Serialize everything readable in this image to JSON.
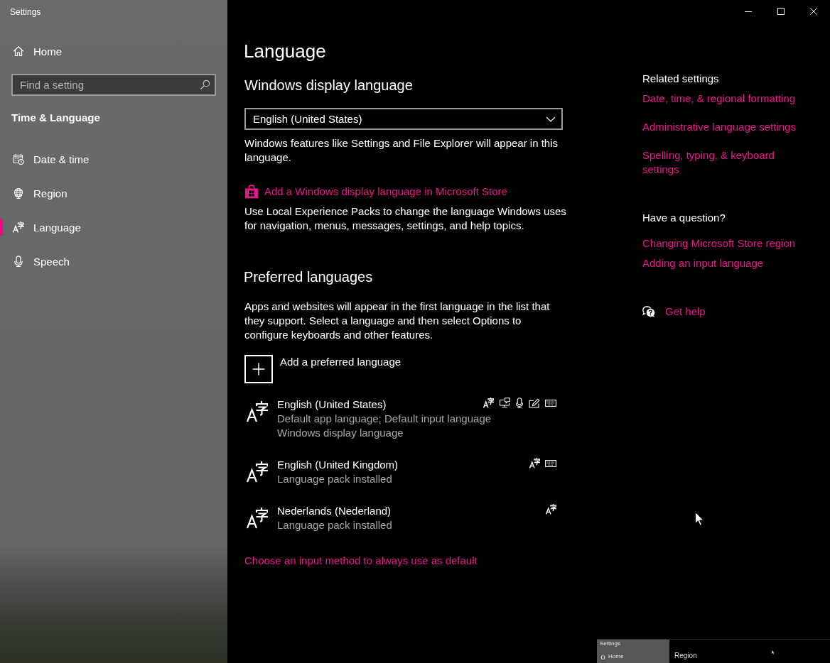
{
  "window": {
    "title": "Settings"
  },
  "sidebar": {
    "home": {
      "label": "Home"
    },
    "search": {
      "placeholder": "Find a setting"
    },
    "section": "Time & Language",
    "items": [
      {
        "label": "Date & time",
        "kind": "date-time",
        "selected": false
      },
      {
        "label": "Region",
        "kind": "region",
        "selected": false
      },
      {
        "label": "Language",
        "kind": "language",
        "selected": true
      },
      {
        "label": "Speech",
        "kind": "speech",
        "selected": false
      }
    ]
  },
  "page": {
    "title": "Language"
  },
  "display_language": {
    "heading": "Windows display language",
    "dropdown": {
      "value": "English (United States)"
    },
    "description": "Windows features like Settings and File Explorer will appear in this language.",
    "store_link": "Add a Windows display language in Microsoft Store",
    "store_note": "Use Local Experience Packs to change the language Windows uses for navigation, menus, messages, settings, and help topics."
  },
  "preferred_languages": {
    "heading": "Preferred languages",
    "description": "Apps and websites will appear in the first language in the list that they support. Select a language and then select Options to configure keyboards and other features.",
    "add_button": "Add a preferred language",
    "languages": [
      {
        "name": "English (United States)",
        "details": [
          "Default app language; Default input language",
          "Windows display language"
        ],
        "features": {
          "language_pack": true,
          "text_to_speech": true,
          "speech": true,
          "handwriting": true,
          "keyboard": true
        }
      },
      {
        "name": "English (United Kingdom)",
        "details": [
          "Language pack installed"
        ],
        "features": {
          "language_pack": true,
          "text_to_speech": false,
          "speech": false,
          "handwriting": false,
          "keyboard": true
        }
      },
      {
        "name": "Nederlands (Nederland)",
        "details": [
          "Language pack installed"
        ],
        "features": {
          "language_pack": true,
          "text_to_speech": false,
          "speech": false,
          "handwriting": false,
          "keyboard": false
        }
      }
    ],
    "input_method_link": "Choose an input method to always use as default"
  },
  "related_settings": {
    "heading": "Related settings",
    "links": [
      "Date, time, & regional formatting",
      "Administrative language settings",
      "Spelling, typing, & keyboard settings"
    ]
  },
  "help": {
    "heading": "Have a question?",
    "links": [
      "Changing Microsoft Store region",
      "Adding an input language"
    ],
    "get_help": "Get help"
  },
  "window_preview": {
    "title": "Settings",
    "home": "Home",
    "page_title": "Region"
  }
}
